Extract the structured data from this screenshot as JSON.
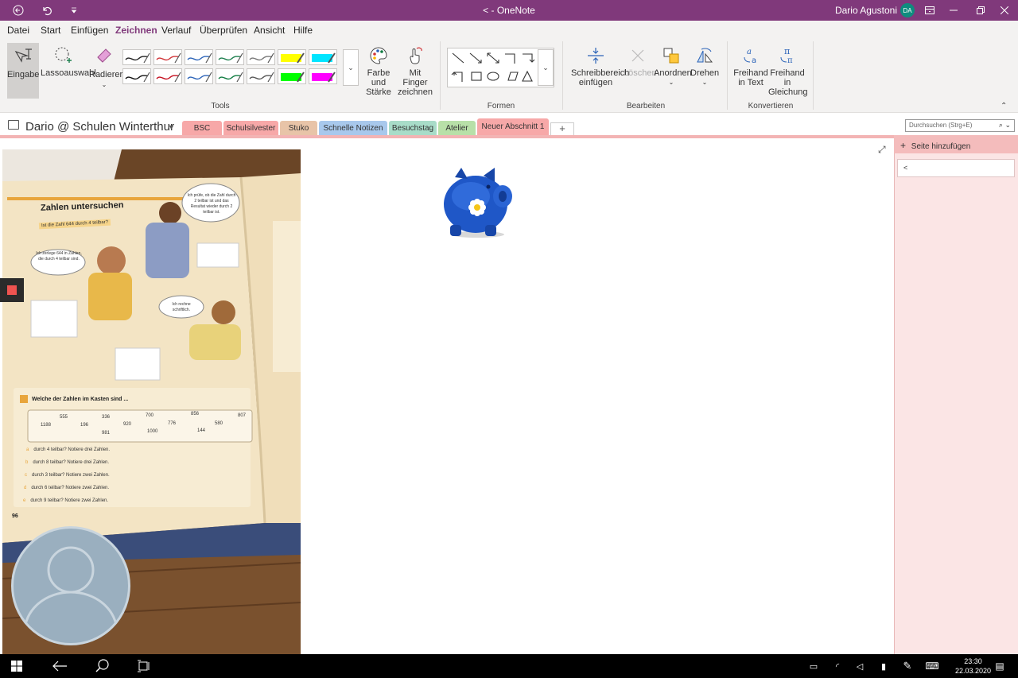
{
  "titlebar": {
    "title": "OneNote",
    "prefix": "<  -",
    "user_name": "Dario Agustoni",
    "user_initials": "DA"
  },
  "menu": {
    "tabs": [
      "Datei",
      "Start",
      "Einfügen",
      "Zeichnen",
      "Verlauf",
      "Überprüfen",
      "Ansicht",
      "Hilfe"
    ],
    "active": "Zeichnen"
  },
  "ribbon": {
    "tools": {
      "eingabe": "Eingabe",
      "lasso": "Lassoauswahl",
      "radierer": "Radierer",
      "farbe": "Farbe und Stärke",
      "finger": "Mit Finger zeichnen",
      "label": "Tools"
    },
    "formen": {
      "label": "Formen"
    },
    "bearbeiten": {
      "schreibbereich": "Schreibbereich einfügen",
      "loeschen": "Löschen",
      "anordnen": "Anordnen",
      "drehen": "Drehen",
      "label": "Bearbeiten"
    },
    "konvertieren": {
      "text": "Freihand in Text",
      "gleichung": "Freihand in Gleichung",
      "label": "Konvertieren"
    },
    "pens": [
      {
        "color": "#222222",
        "type": "pen"
      },
      {
        "color": "#d13438",
        "type": "pen"
      },
      {
        "color": "#2b63b8",
        "type": "pen"
      },
      {
        "color": "#1d7f4e",
        "type": "pen"
      },
      {
        "color": "#777777",
        "type": "pen"
      },
      {
        "color": "#ffff00",
        "type": "highlighter"
      },
      {
        "color": "#00e5ff",
        "type": "highlighter"
      },
      {
        "color": "#111111",
        "type": "pen"
      },
      {
        "color": "#c50f1f",
        "type": "pen"
      },
      {
        "color": "#2b63b8",
        "type": "pen"
      },
      {
        "color": "#107c41",
        "type": "pen"
      },
      {
        "color": "#555555",
        "type": "pen"
      },
      {
        "color": "#00ff00",
        "type": "highlighter"
      },
      {
        "color": "#ff00ff",
        "type": "highlighter"
      }
    ]
  },
  "notebook": {
    "name": "Dario @ Schulen Winterthur"
  },
  "sections": [
    {
      "label": "BSC",
      "color": "#f7a8a8"
    },
    {
      "label": "Schulsilvester",
      "color": "#f7a8a8"
    },
    {
      "label": "Stuko",
      "color": "#e8c4a8"
    },
    {
      "label": "Schnelle Notizen",
      "color": "#a8c8ec"
    },
    {
      "label": "Besuchstag",
      "color": "#a8dcc8"
    },
    {
      "label": "Atelier",
      "color": "#b8e0a8"
    },
    {
      "label": "Neuer Abschnitt 1",
      "color": "#f7a8a8"
    }
  ],
  "search": {
    "placeholder": "Durchsuchen (Strg+E)"
  },
  "pages": {
    "add_label": "Seite hinzufügen",
    "items": [
      "<"
    ]
  },
  "book": {
    "heading": "Zahlen untersuchen",
    "question": "Ist die Zahl 644 durch 4 teilbar?",
    "bubble1": "Ich zerlege 644 in Zahlen, die durch 4 teilbar sind.",
    "bubble2": "Ich prüfe, ob die Zahl durch 2 teilbar ist und das Resultat wieder durch 2 teilbar ist.",
    "bubble3": "Ich rechne schriftlich.",
    "task_title": "Welche der Zahlen im Kasten sind ...",
    "numbers": [
      "555",
      "336",
      "700",
      "856",
      "807",
      "1188",
      "196",
      "920",
      "776",
      "580",
      "981",
      "1000",
      "144"
    ],
    "tasks": [
      "durch 4 teilbar? Notiere drei Zahlen.",
      "durch 8 teilbar? Notiere drei Zahlen.",
      "durch 3 teilbar? Notiere zwei Zahlen.",
      "durch 6 teilbar? Notiere zwei Zahlen.",
      "durch 9 teilbar? Notiere zwei Zahlen."
    ],
    "task_letters": [
      "a",
      "b",
      "c",
      "d",
      "e"
    ],
    "page_no": "96"
  },
  "taskbar": {
    "time": "23:30",
    "date": "22.03.2020"
  }
}
